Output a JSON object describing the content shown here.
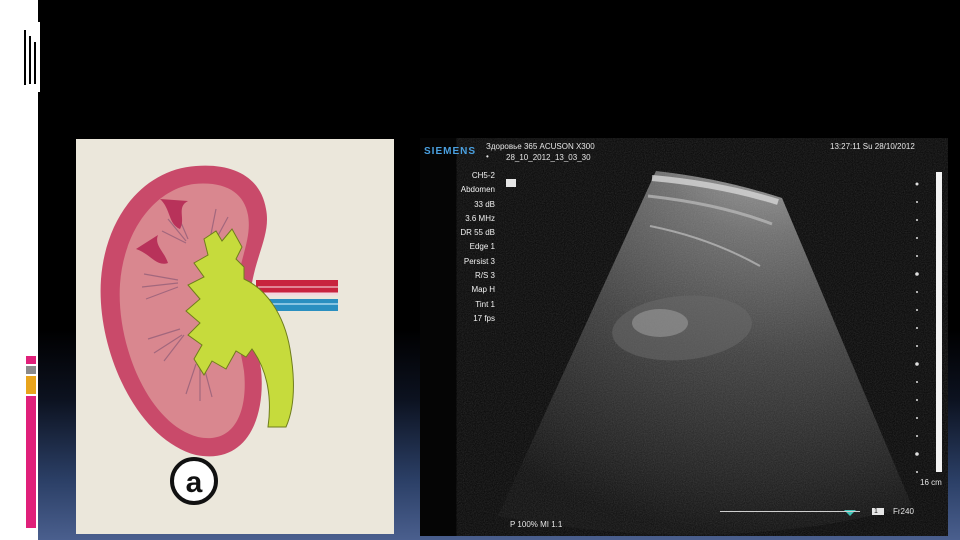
{
  "ultrasound": {
    "brand": "SIEMENS",
    "header_line1": "Здоровье 365 ACUSON X300",
    "header_line2": "28_10_2012_13_03_30",
    "datetime": "13:27:11  Su 28/10/2012",
    "params": [
      "CH5-2",
      "Abdomen",
      "33 dB",
      "3.6 MHz",
      "DR 55 dB",
      "Edge 1",
      "Persist 3",
      "R/S 3",
      "Map H",
      "Tint 1",
      "17 fps"
    ],
    "depth": "16 cm",
    "frame": "Fr240",
    "frame_index": "1",
    "footer": "P 100%   MI 1.1"
  },
  "kidney_diagram": {
    "label": "a"
  },
  "colors": {
    "cortex": "#c94a6a",
    "medulla": "#d9878f",
    "pelvis": "#c6db3c",
    "artery": "#c8243e",
    "vein": "#2a8fc0"
  }
}
